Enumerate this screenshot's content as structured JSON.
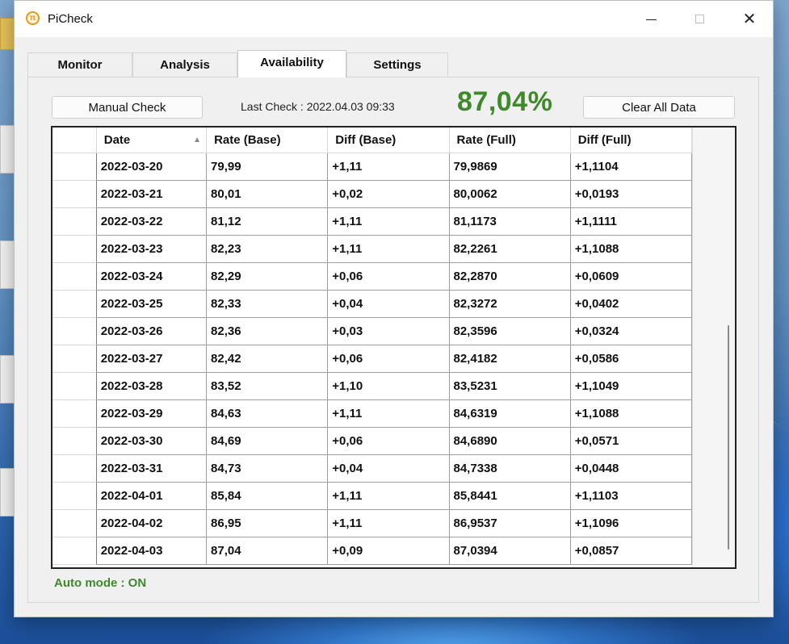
{
  "window": {
    "title": "PiCheck",
    "icon": "pi-coin-icon",
    "controls": {
      "minimize": "minimize-icon",
      "maximize": "maximize-icon",
      "close": "close-icon",
      "close_glyph": "✕"
    }
  },
  "tabs": [
    {
      "label": "Monitor",
      "active": false
    },
    {
      "label": "Analysis",
      "active": false
    },
    {
      "label": "Availability",
      "active": true
    },
    {
      "label": "Settings",
      "active": false
    }
  ],
  "toolbar": {
    "manual_check_label": "Manual Check",
    "last_check_text": "Last Check : 2022.04.03 09:33",
    "availability_percent": "87,04%",
    "clear_all_label": "Clear All Data"
  },
  "table": {
    "columns": [
      "Date",
      "Rate (Base)",
      "Diff (Base)",
      "Rate (Full)",
      "Diff (Full)"
    ],
    "sort_indicator": "▲",
    "rows": [
      [
        "2022-03-20",
        "79,99",
        "+1,11",
        "79,9869",
        "+1,1104"
      ],
      [
        "2022-03-21",
        "80,01",
        "+0,02",
        "80,0062",
        "+0,0193"
      ],
      [
        "2022-03-22",
        "81,12",
        "+1,11",
        "81,1173",
        "+1,1111"
      ],
      [
        "2022-03-23",
        "82,23",
        "+1,11",
        "82,2261",
        "+1,1088"
      ],
      [
        "2022-03-24",
        "82,29",
        "+0,06",
        "82,2870",
        "+0,0609"
      ],
      [
        "2022-03-25",
        "82,33",
        "+0,04",
        "82,3272",
        "+0,0402"
      ],
      [
        "2022-03-26",
        "82,36",
        "+0,03",
        "82,3596",
        "+0,0324"
      ],
      [
        "2022-03-27",
        "82,42",
        "+0,06",
        "82,4182",
        "+0,0586"
      ],
      [
        "2022-03-28",
        "83,52",
        "+1,10",
        "83,5231",
        "+1,1049"
      ],
      [
        "2022-03-29",
        "84,63",
        "+1,11",
        "84,6319",
        "+1,1088"
      ],
      [
        "2022-03-30",
        "84,69",
        "+0,06",
        "84,6890",
        "+0,0571"
      ],
      [
        "2022-03-31",
        "84,73",
        "+0,04",
        "84,7338",
        "+0,0448"
      ],
      [
        "2022-04-01",
        "85,84",
        "+1,11",
        "85,8441",
        "+1,1103"
      ],
      [
        "2022-04-02",
        "86,95",
        "+1,11",
        "86,9537",
        "+1,1096"
      ],
      [
        "2022-04-03",
        "87,04",
        "+0,09",
        "87,0394",
        "+0,0857"
      ]
    ]
  },
  "status": {
    "auto_mode_text": "Auto mode : ON"
  },
  "colors": {
    "accent_green": "#3e8a2a"
  }
}
